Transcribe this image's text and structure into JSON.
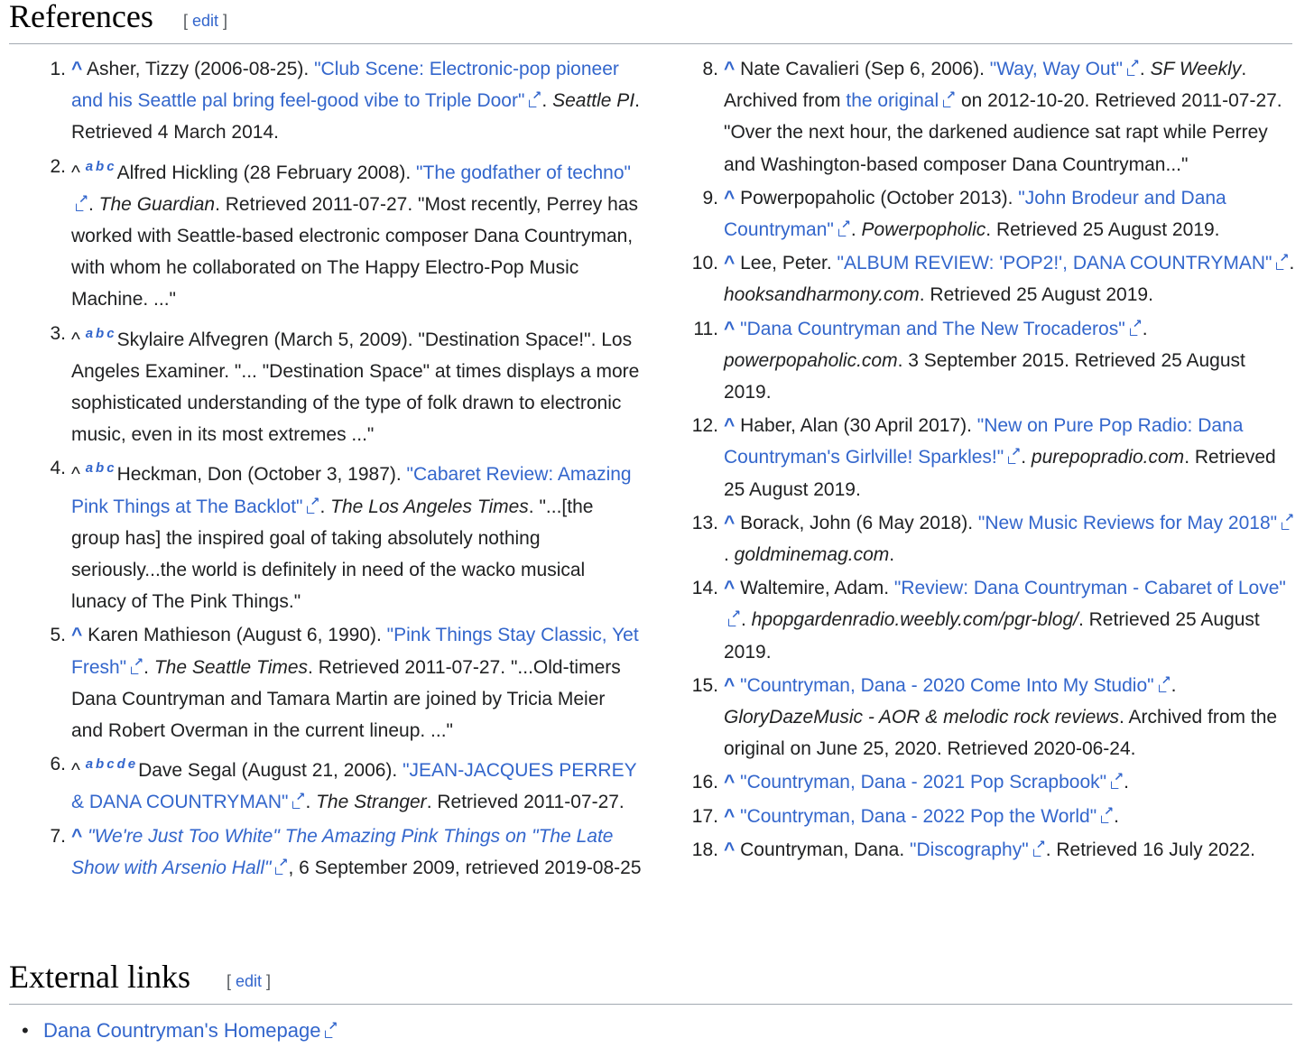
{
  "references_heading": {
    "title": "References",
    "edit_open": "[ ",
    "edit": "edit",
    "edit_close": " ]"
  },
  "external_links_heading": {
    "title": "External links",
    "edit_open": "[ ",
    "edit": "edit",
    "edit_close": " ]"
  },
  "refs": [
    {
      "num": "1.",
      "caret": "^",
      "letters": [],
      "t1": "Asher, Tizzy (2006-08-25). ",
      "link": "\"Club Scene: Electronic-pop pioneer and his Seattle pal bring feel-good vibe to Triple Door\"",
      "t2": ". ",
      "italic": "Seattle PI",
      "t3": ". Retrieved 4 March 2014."
    },
    {
      "num": "2.",
      "caret": "^",
      "letters": [
        "a",
        "b",
        "c"
      ],
      "t1": "Alfred Hickling (28 February 2008). ",
      "link": "\"The godfather of techno\"",
      "t2": ". ",
      "italic": "The Guardian",
      "t3": ". Retrieved 2011-07-27. \"Most recently, Perrey has worked with Seattle-based electronic composer Dana Countryman, with whom he collaborated on The Happy Electro-Pop Music Machine. ...\""
    },
    {
      "num": "3.",
      "caret": "^",
      "letters": [
        "a",
        "b",
        "c"
      ],
      "t1": "Skylaire Alfvegren (March 5, 2009). \"Destination Space!\". Los Angeles Examiner. \"... \"Destination Space\" at times displays a more sophisticated understanding of the type of folk drawn to electronic music, even in its most extremes ...\"",
      "link": "",
      "t2": "",
      "italic": "",
      "t3": ""
    },
    {
      "num": "4.",
      "caret": "^",
      "letters": [
        "a",
        "b",
        "c"
      ],
      "t1": "Heckman, Don (October 3, 1987). ",
      "link": "\"Cabaret Review: Amazing Pink Things at The Backlot\"",
      "t2": ". ",
      "italic": "The Los Angeles Times",
      "t3": ". \"...[the group has] the inspired goal of taking absolutely nothing seriously...the world is definitely in need of the wacko musical lunacy of The Pink Things.\""
    },
    {
      "num": "5.",
      "caret": "^",
      "letters": [],
      "t1": "Karen Mathieson (August 6, 1990). ",
      "link": "\"Pink Things Stay Classic, Yet Fresh\"",
      "t2": ". ",
      "italic": "The Seattle Times",
      "t3": ". Retrieved 2011-07-27. \"...Old-timers Dana Countryman and Tamara Martin are joined by Tricia Meier and Robert Overman in the current lineup. ...\""
    },
    {
      "num": "6.",
      "caret": "^",
      "letters": [
        "a",
        "b",
        "c",
        "d",
        "e"
      ],
      "t1": "Dave Segal (August 21, 2006). ",
      "link": "\"JEAN-JACQUES PERREY & DANA COUNTRYMAN\"",
      "t2": ". ",
      "italic": "The Stranger",
      "t3": ". Retrieved 2011-07-27."
    },
    {
      "num": "7.",
      "caret": "^",
      "letters": [],
      "t1": "",
      "link": "\"We're Just Too White\" The Amazing Pink Things on \"The Late Show with Arsenio Hall\"",
      "link_italic": true,
      "t2": ", 6 September 2009, retrieved 2019-08-25",
      "italic": "",
      "t3": ""
    }
  ],
  "refs2": [
    {
      "num": "8.",
      "caret": "^",
      "letters": [],
      "t1": "Nate Cavalieri (Sep 6, 2006). ",
      "link": "\"Way, Way Out\"",
      "t2": ". ",
      "italic": "SF Weekly",
      "t3": ". Archived from ",
      "link2": "the original",
      "t4": " on 2012-10-20. Retrieved 2011-07-27. \"Over the next hour, the darkened audience sat rapt while Perrey and Washington-based composer Dana Countryman...\""
    },
    {
      "num": "9.",
      "caret": "^",
      "letters": [],
      "t1": "Powerpopaholic (October 2013). ",
      "link": "\"John Brodeur and Dana Countryman\"",
      "t2": ". ",
      "italic": "Powerpopholic",
      "t3": ". Retrieved 25 August 2019."
    },
    {
      "num": "10.",
      "caret": "^",
      "letters": [],
      "t1": "Lee, Peter. ",
      "link": "\"ALBUM REVIEW: 'POP2!', DANA COUNTRYMAN\"",
      "t2": ". ",
      "italic": "hooksandharmony.com",
      "t3": ". Retrieved 25 August 2019."
    },
    {
      "num": "11.",
      "caret": "^",
      "letters": [],
      "t1": "",
      "link": "\"Dana Countryman and The New Trocaderos\"",
      "t2": ". ",
      "italic": "powerpopaholic.com",
      "t3": ". 3 September 2015. Retrieved 25 August 2019."
    },
    {
      "num": "12.",
      "caret": "^",
      "letters": [],
      "t1": "Haber, Alan (30 April 2017). ",
      "link": "\"New on Pure Pop Radio: Dana Countryman's Girlville! Sparkles!\"",
      "t2": ". ",
      "italic": "purepopradio.com",
      "t3": ". Retrieved 25 August 2019."
    },
    {
      "num": "13.",
      "caret": "^",
      "letters": [],
      "t1": "Borack, John (6 May 2018). ",
      "link": "\"New Music Reviews for May 2018\"",
      "t2": ". ",
      "italic": "goldminemag.com",
      "t3": "."
    },
    {
      "num": "14.",
      "caret": "^",
      "letters": [],
      "t1": "Waltemire, Adam. ",
      "link": "\"Review: Dana Countryman - Cabaret of Love\"",
      "t2": ". ",
      "italic": "hpopgardenradio.weebly.com/pgr-blog/",
      "t3": ". Retrieved 25 August 2019."
    },
    {
      "num": "15.",
      "caret": "^",
      "letters": [],
      "t1": "",
      "link": "\"Countryman, Dana - 2020 Come Into My Studio\"",
      "t2": ". ",
      "italic": "GloryDazeMusic - AOR & melodic rock reviews",
      "t3": ". Archived from the original on June 25, 2020. Retrieved 2020-06-24."
    },
    {
      "num": "16.",
      "caret": "^",
      "letters": [],
      "t1": "",
      "link": "\"Countryman, Dana - 2021 Pop Scrapbook\"",
      "t2": ".",
      "italic": "",
      "t3": ""
    },
    {
      "num": "17.",
      "caret": "^",
      "letters": [],
      "t1": "",
      "link": "\"Countryman, Dana - 2022 Pop the World\"",
      "t2": ".",
      "italic": "",
      "t3": ""
    },
    {
      "num": "18.",
      "caret": "^",
      "letters": [],
      "t1": "Countryman, Dana. ",
      "link": "\"Discography\"",
      "t2": ". Retrieved 16 July 2022.",
      "italic": "",
      "t3": ""
    }
  ],
  "external_links": [
    {
      "label": "Dana Countryman's Homepage"
    }
  ],
  "icons": {
    "external_link": "external-link-icon"
  },
  "colors": {
    "link": "#3366cc",
    "text": "#202122",
    "rule": "#a2a9b1"
  }
}
